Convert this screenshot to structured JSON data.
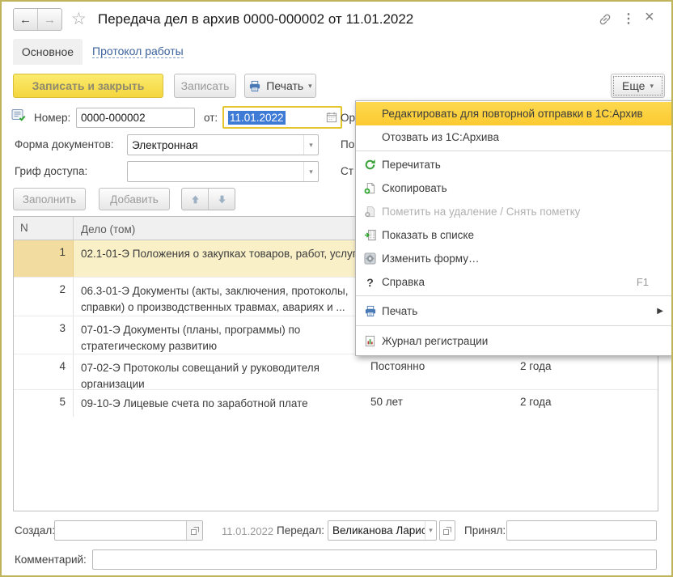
{
  "window": {
    "title": "Передача дел в архив 0000-000002 от 11.01.2022"
  },
  "icons": {
    "back": "←",
    "forward": "→",
    "star": "☆",
    "kebab": "⋮",
    "close": "×",
    "dropdown": "▾",
    "submenu": "▶",
    "help": "?"
  },
  "tabs": {
    "main": "Основное",
    "protocol": "Протокол работы"
  },
  "toolbar": {
    "save_close": "Записать и закрыть",
    "save": "Записать",
    "print": "Печать",
    "more": "Еще"
  },
  "form": {
    "number_label": "Номер:",
    "number_value": "0000-000002",
    "date_label": "от:",
    "date_value": "11.01.2022",
    "org_label_cut": "Ор",
    "docform_label": "Форма документов:",
    "docform_value": "Электронная",
    "field2_label_cut": "По",
    "grif_label": "Гриф доступа:",
    "grif_value": "",
    "field3_label_cut": "Ст",
    "fill_btn": "Заполнить",
    "add_btn": "Добавить"
  },
  "table": {
    "headers": {
      "n": "N",
      "delo": "Дело (том)"
    },
    "rows": [
      {
        "n": "1",
        "delo": "02.1-01-Э Положения о закупках товаров, работ, услуг",
        "col3": "",
        "col4": ""
      },
      {
        "n": "2",
        "delo": "06.3-01-Э Документы (акты, заключения, протоколы, справки) о производственных травмах, авариях и ...",
        "col3": "",
        "col4": ""
      },
      {
        "n": "3",
        "delo": "07-01-Э Документы (планы, программы) по стратегическому развитию",
        "col3": "",
        "col4": ""
      },
      {
        "n": "4",
        "delo": "07-02-Э Протоколы совещаний у руководителя организации",
        "col3": "Постоянно",
        "col4": "2 года"
      },
      {
        "n": "5",
        "delo": "09-10-Э Лицевые счета по заработной плате",
        "col3": "50 лет",
        "col4": "2 года"
      }
    ]
  },
  "menu": {
    "items": [
      {
        "label": "Редактировать для повторной отправки в 1С:Архив"
      },
      {
        "label": "Отозвать из 1С:Архива"
      },
      {
        "label": "Перечитать"
      },
      {
        "label": "Скопировать"
      },
      {
        "label": "Пометить на удаление / Снять пометку"
      },
      {
        "label": "Показать в списке"
      },
      {
        "label": "Изменить форму…"
      },
      {
        "label": "Справка",
        "shortcut": "F1"
      },
      {
        "label": "Печать"
      },
      {
        "label": "Журнал регистрации"
      }
    ]
  },
  "footer": {
    "created_label": "Создал:",
    "created_value": "",
    "date": "11.01.2022",
    "passed_label": "Передал:",
    "passed_value": "Великанова Лариса",
    "received_label": "Принял:",
    "received_value": "",
    "comment_label": "Комментарий:",
    "comment_value": ""
  },
  "colors": {
    "accent_yellow": "#f4d63e",
    "menu_highlight": "#fbd345",
    "selection_blue": "#3e7bd6",
    "link_blue": "#3b639c",
    "window_border": "#bfb45a"
  }
}
